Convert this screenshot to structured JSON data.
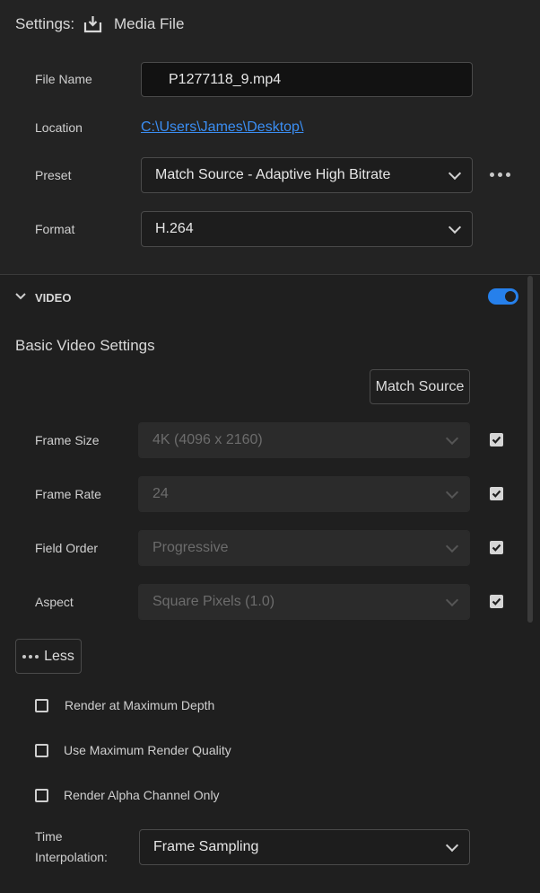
{
  "header": {
    "settings_label": "Settings:",
    "media_label": "Media File"
  },
  "fields": {
    "file_name": {
      "label": "File Name",
      "value": "P1277118_9.mp4"
    },
    "location": {
      "label": "Location",
      "value": "C:\\Users\\James\\Desktop\\"
    },
    "preset": {
      "label": "Preset",
      "value": "Match Source - Adaptive High Bitrate"
    },
    "format": {
      "label": "Format",
      "value": "H.264"
    }
  },
  "video": {
    "section_label": "VIDEO",
    "toggle_on": true,
    "basic_title": "Basic Video Settings",
    "match_source_label": "Match Source",
    "rows": [
      {
        "label": "Frame Size",
        "value": "4K (4096 x 2160)",
        "checked": true
      },
      {
        "label": "Frame Rate",
        "value": "24",
        "checked": true
      },
      {
        "label": "Field Order",
        "value": "Progressive",
        "checked": true
      },
      {
        "label": "Aspect",
        "value": "Square Pixels (1.0)",
        "checked": true
      }
    ],
    "less_label": "Less",
    "options": [
      {
        "label": "Render at Maximum Depth",
        "checked": false
      },
      {
        "label": "Use Maximum Render Quality",
        "checked": false
      },
      {
        "label": "Render Alpha Channel Only",
        "checked": false
      }
    ],
    "time_interpolation": {
      "label_line1": "Time",
      "label_line2": "Interpolation:",
      "value": "Frame Sampling"
    }
  },
  "colors": {
    "accent": "#2680eb",
    "link": "#3b8ef3",
    "background": "#1f1f1f"
  }
}
